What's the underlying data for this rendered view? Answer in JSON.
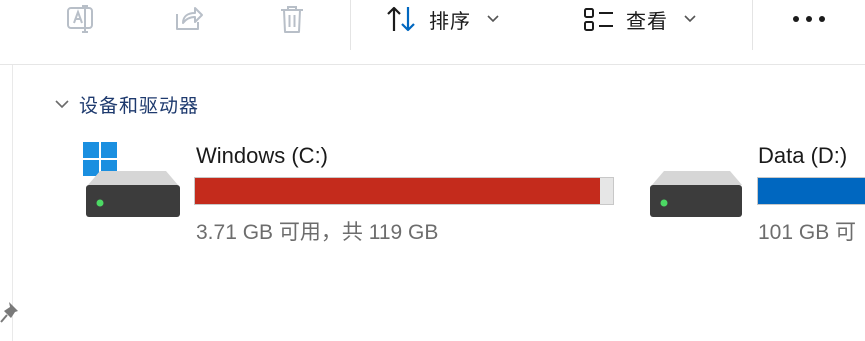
{
  "toolbar": {
    "rename_icon": "rename-icon",
    "share_icon": "share-icon",
    "delete_icon": "trash-icon",
    "sort_label": "排序",
    "view_label": "查看",
    "more_icon": "more-dots-icon"
  },
  "group": {
    "title": "设备和驱动器",
    "expanded": true
  },
  "drives": [
    {
      "name": "Windows (C:)",
      "info": "3.71 GB 可用，共 119 GB",
      "used_fraction": 0.969,
      "bar_color": "#c42b1c",
      "has_windows_logo": true
    },
    {
      "name": "Data (D:)",
      "info": "101 GB 可",
      "bar_color": "#0067c0",
      "has_windows_logo": false
    }
  ],
  "colors": {
    "accent": "#0067c0",
    "critical": "#c42b1c",
    "group_title": "#1e3a6e"
  }
}
